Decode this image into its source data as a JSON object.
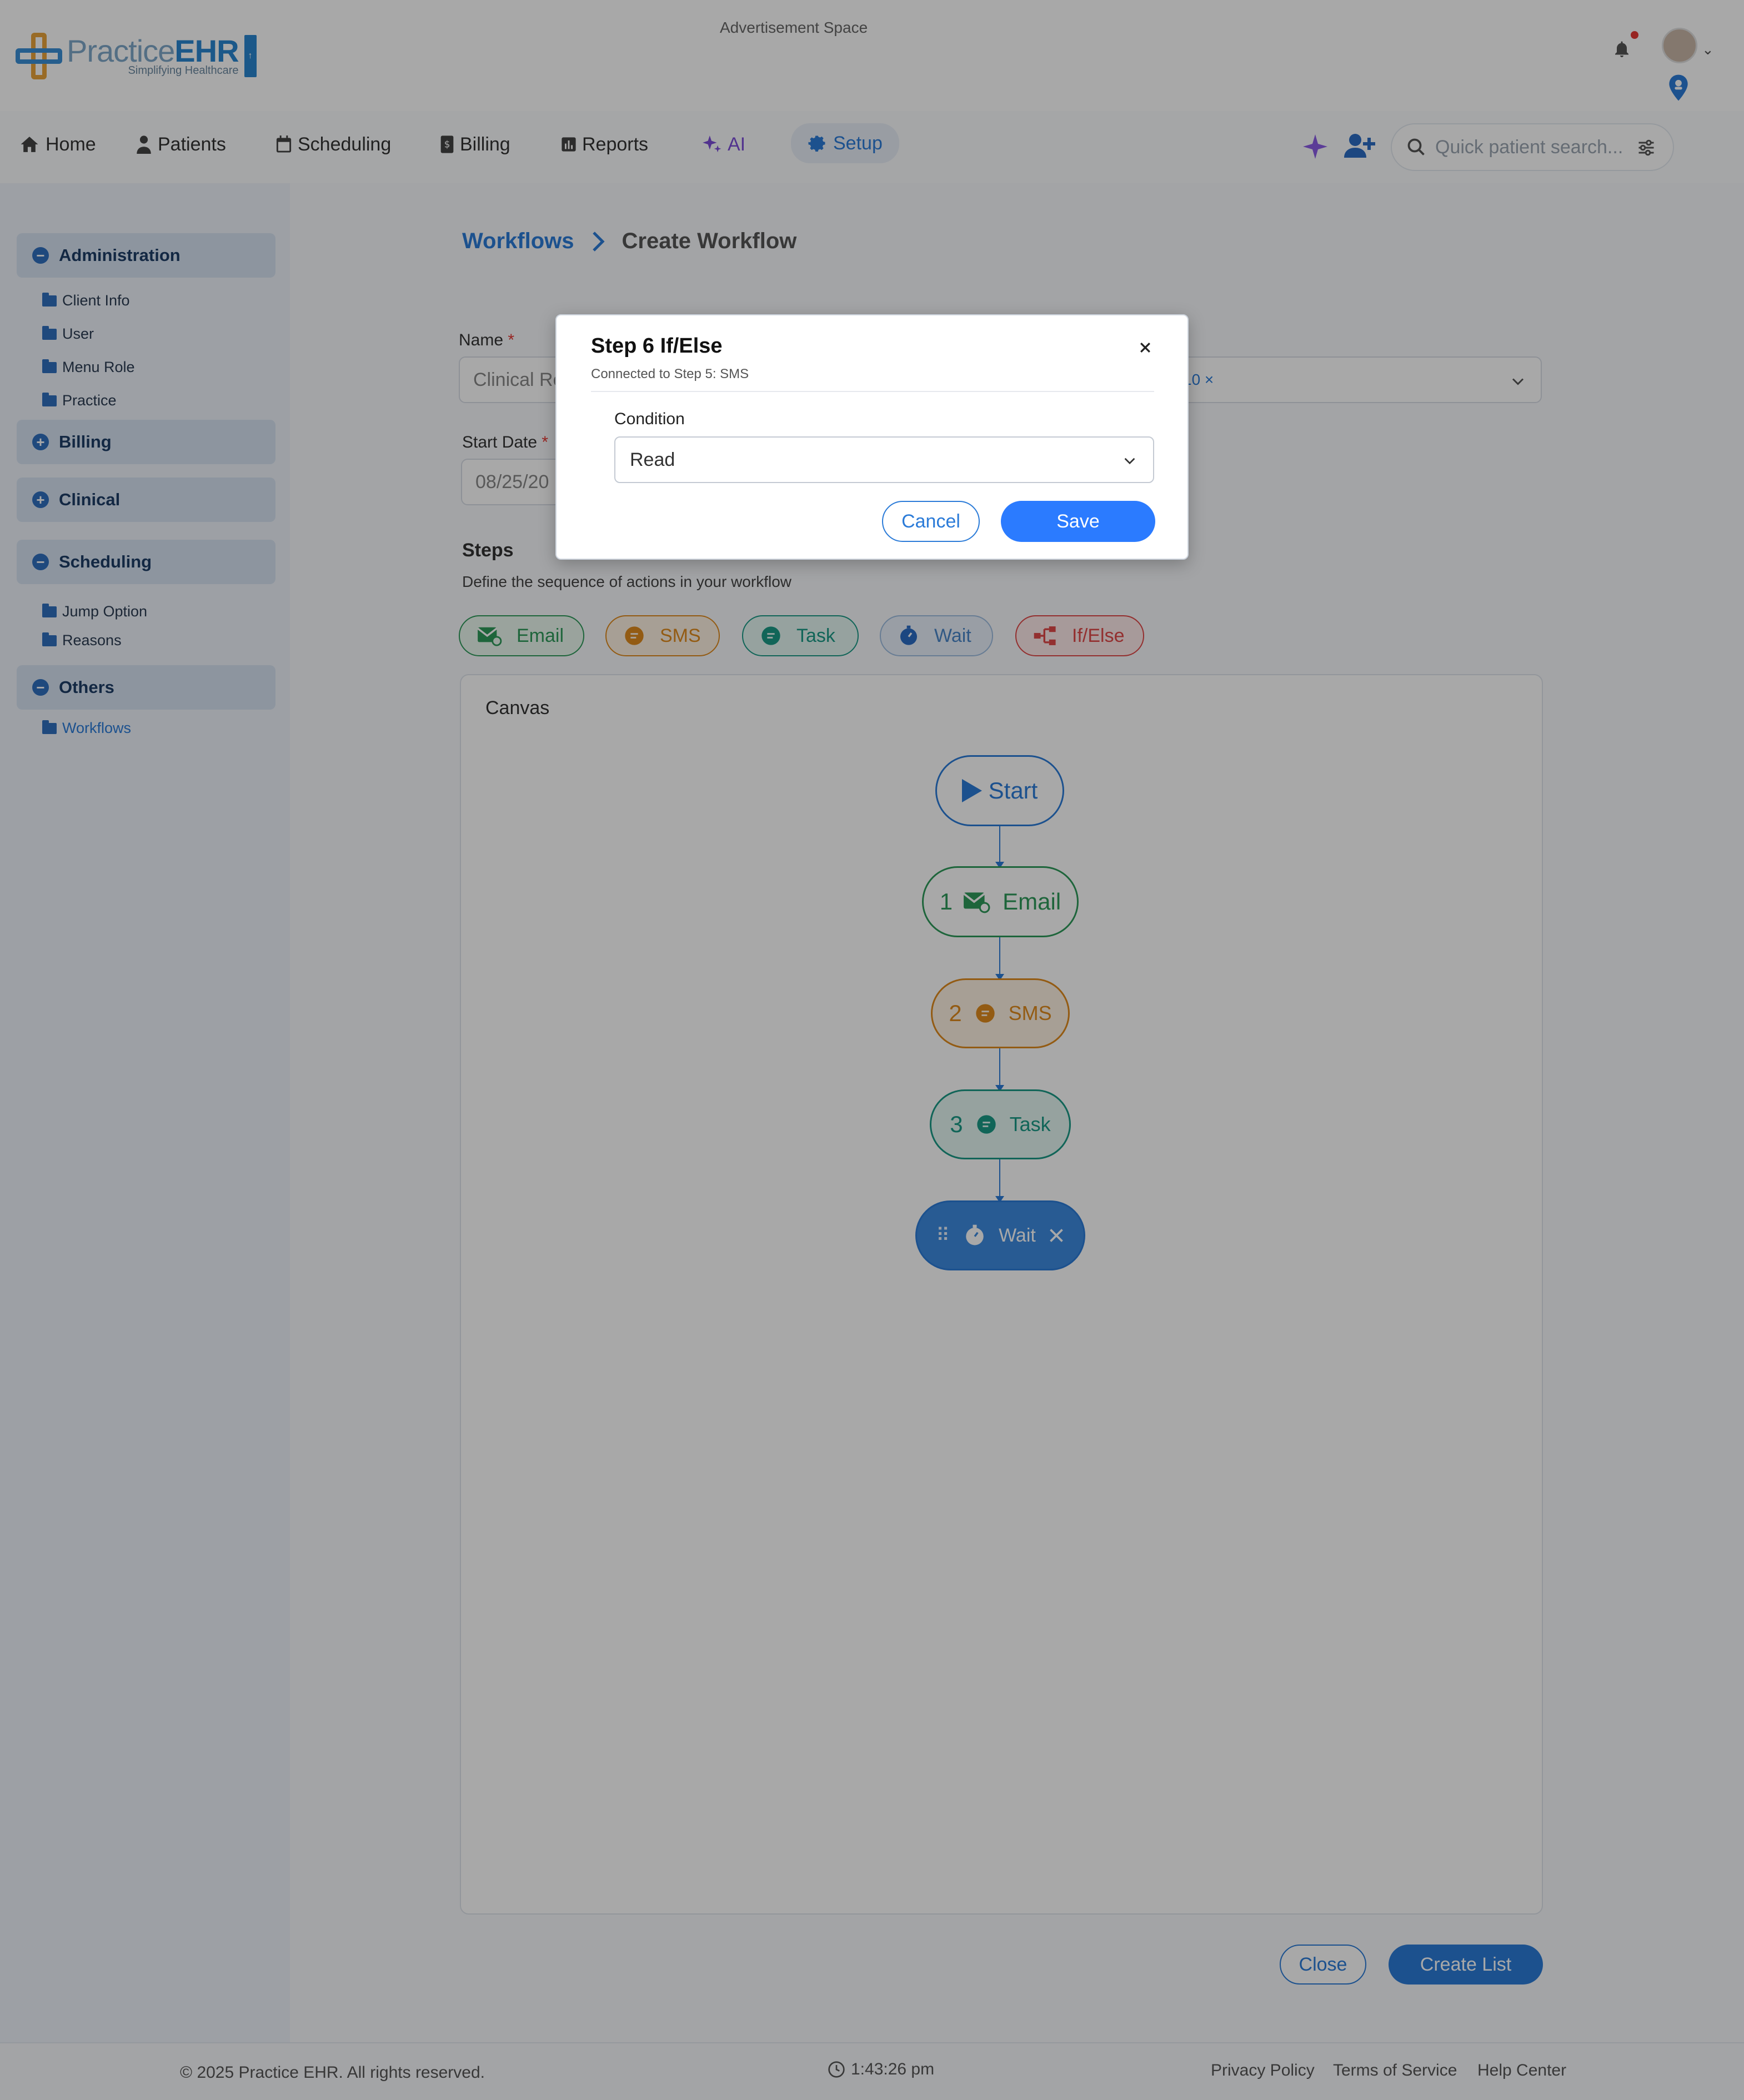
{
  "header": {
    "logo_name_light": "Practice",
    "logo_name_bold": "EHR",
    "logo_tagline": "Simplifying Healthcare",
    "ad_space": "Advertisement Space"
  },
  "nav": {
    "items": [
      {
        "label": "Home"
      },
      {
        "label": "Patients"
      },
      {
        "label": "Scheduling"
      },
      {
        "label": "Billing"
      },
      {
        "label": "Reports"
      },
      {
        "label": "AI"
      },
      {
        "label": "Setup"
      }
    ],
    "search_placeholder": "Quick patient search..."
  },
  "sidebar": {
    "groups": [
      {
        "label": "Administration",
        "toggle": "−"
      },
      {
        "label": "Billing",
        "toggle": "+"
      },
      {
        "label": "Clinical",
        "toggle": "+"
      },
      {
        "label": "Scheduling",
        "toggle": "−"
      },
      {
        "label": "Others",
        "toggle": "−"
      }
    ],
    "admin_items": [
      "Client Info",
      "User",
      "Menu Role",
      "Practice"
    ],
    "scheduling_items": [
      "Jump Option",
      "Reasons"
    ],
    "others_items": [
      "Workflows"
    ]
  },
  "breadcrumb": {
    "parent": "Workflows",
    "current": "Create Workflow"
  },
  "form": {
    "name_label": "Name",
    "name_value": "Clinical Re",
    "tag_partial": "10 ×",
    "start_date_label": "Start Date",
    "start_date_value": "08/25/20",
    "required_mark": "*"
  },
  "steps": {
    "title": "Steps",
    "subtitle": "Define the sequence of actions in your workflow",
    "chips": [
      {
        "label": "Email",
        "color": "#2e9a5a"
      },
      {
        "label": "SMS",
        "color": "#e08a1e"
      },
      {
        "label": "Task",
        "color": "#1a9a86"
      },
      {
        "label": "Wait",
        "color": "#4a86c8"
      },
      {
        "label": "If/Else",
        "color": "#e04848"
      }
    ]
  },
  "canvas": {
    "title": "Canvas",
    "nodes": [
      {
        "num": "",
        "label": "Start"
      },
      {
        "num": "1",
        "label": "Email"
      },
      {
        "num": "2",
        "label": "SMS"
      },
      {
        "num": "3",
        "label": "Task"
      },
      {
        "num": "",
        "label": "Wait"
      }
    ]
  },
  "actions": {
    "close": "Close",
    "create": "Create List"
  },
  "footer": {
    "copyright": "© 2025 Practice EHR. All rights reserved.",
    "time": "1:43:26 pm",
    "links": [
      "Privacy Policy",
      "Terms of Service",
      "Help Center"
    ]
  },
  "modal": {
    "title": "Step 6 If/Else",
    "subtitle": "Connected to Step 5: SMS",
    "condition_label": "Condition",
    "condition_value": "Read",
    "cancel": "Cancel",
    "save": "Save"
  },
  "colors": {
    "primary": "#2b7bd8",
    "overlay": "rgba(0,0,0,0.34)"
  }
}
